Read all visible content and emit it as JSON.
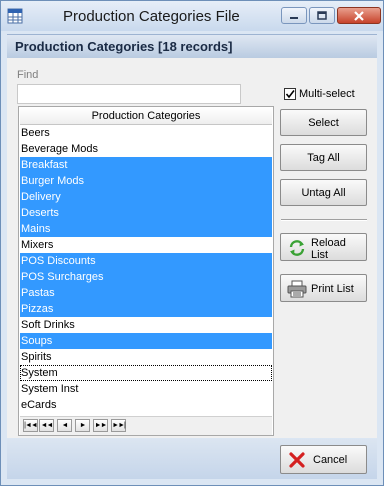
{
  "window": {
    "title": "Production Categories File"
  },
  "header": {
    "title": "Production Categories [18 records]"
  },
  "find": {
    "label": "Find",
    "value": ""
  },
  "multi_select": {
    "label": "Multi-select",
    "checked": true
  },
  "list": {
    "column_header": "Production Categories",
    "items": [
      {
        "label": "Beers",
        "selected": false
      },
      {
        "label": "Beverage Mods",
        "selected": false
      },
      {
        "label": "Breakfast",
        "selected": true
      },
      {
        "label": "Burger Mods",
        "selected": true
      },
      {
        "label": "Delivery",
        "selected": true
      },
      {
        "label": "Deserts",
        "selected": true
      },
      {
        "label": "Mains",
        "selected": true
      },
      {
        "label": "Mixers",
        "selected": false
      },
      {
        "label": "POS Discounts",
        "selected": true
      },
      {
        "label": "POS Surcharges",
        "selected": true
      },
      {
        "label": "Pastas",
        "selected": true
      },
      {
        "label": "Pizzas",
        "selected": true
      },
      {
        "label": "Soft Drinks",
        "selected": false
      },
      {
        "label": "Soups",
        "selected": true
      },
      {
        "label": "Spirits",
        "selected": false
      },
      {
        "label": "System",
        "selected": false,
        "focused": true
      },
      {
        "label": "System Inst",
        "selected": false
      },
      {
        "label": "eCards",
        "selected": false
      }
    ],
    "nav_buttons": [
      {
        "name": "first-record",
        "glyph": "|◄◄"
      },
      {
        "name": "prev-page",
        "glyph": "◄◄"
      },
      {
        "name": "prev-record",
        "glyph": "◄"
      },
      {
        "name": "next-record",
        "glyph": "►"
      },
      {
        "name": "next-page",
        "glyph": "►►"
      },
      {
        "name": "last-record",
        "glyph": "►►|"
      }
    ]
  },
  "buttons": {
    "select": "Select",
    "tag_all": "Tag All",
    "untag_all": "Untag All",
    "reload_line1": "Reload",
    "reload_line2": "List",
    "print_list": "Print List",
    "cancel": "Cancel"
  },
  "colors": {
    "selection": "#3399ff",
    "titlebar": "#c9d9ed",
    "close_button": "#c7432b"
  },
  "icons": {
    "app": "grid-app-icon",
    "minimize": "minimize-icon",
    "maximize": "maximize-icon",
    "close": "close-icon",
    "reload": "reload-icon",
    "print": "printer-icon",
    "cancel": "red-x-icon"
  }
}
